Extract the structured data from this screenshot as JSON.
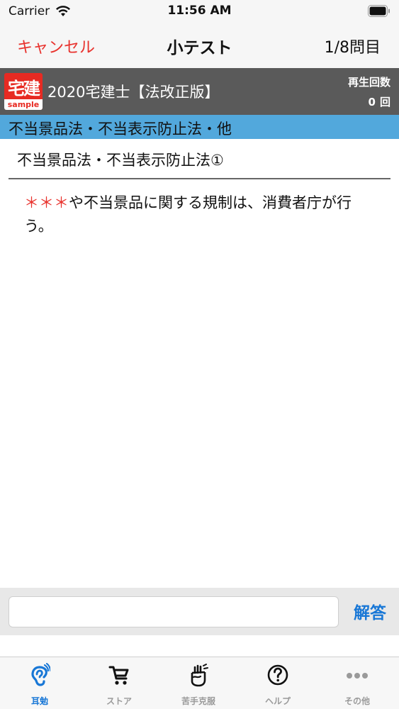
{
  "status": {
    "carrier": "Carrier",
    "time": "11:56 AM"
  },
  "nav": {
    "cancel_label": "キャンセル",
    "title": "小テスト",
    "progress": "1/8問目"
  },
  "book": {
    "logo_text": "宅建",
    "logo_sample": "sample",
    "title": "2020宅建士【法改正版】",
    "play_label": "再生回数",
    "play_count": "0",
    "play_unit": "回"
  },
  "category": {
    "label": "不当景品法・不当表示防止法・他"
  },
  "section": {
    "title": "不当景品法・不当表示防止法①"
  },
  "question": {
    "mask": "＊＊＊",
    "text": "や不当景品に関する規制は、消費者庁が行う。"
  },
  "answer": {
    "placeholder": "",
    "button_label": "解答"
  },
  "tabs": [
    {
      "label": "耳勉",
      "icon": "ear-icon",
      "active": true
    },
    {
      "label": "ストア",
      "icon": "cart-icon",
      "active": false
    },
    {
      "label": "苦手克服",
      "icon": "fist-icon",
      "active": false
    },
    {
      "label": "ヘルプ",
      "icon": "help-icon",
      "active": false
    },
    {
      "label": "その他",
      "icon": "more-icon",
      "active": false
    }
  ],
  "colors": {
    "accent": "#1877d6",
    "cancel": "#e8322d",
    "category_bg": "#52a8dc",
    "header_bg": "#5a5a5a"
  }
}
